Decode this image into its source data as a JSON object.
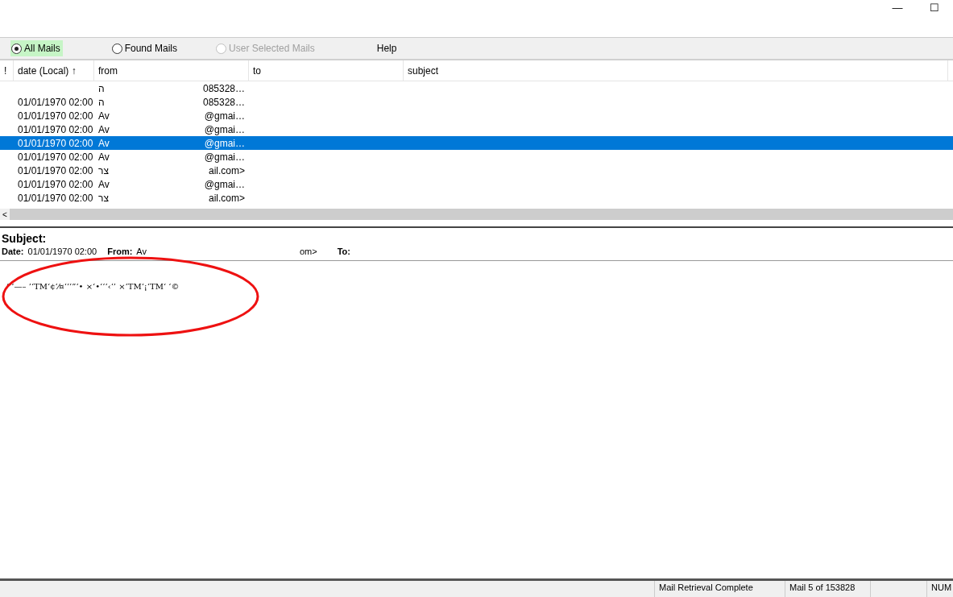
{
  "window": {
    "controls": [
      "—",
      "☐"
    ]
  },
  "toolbar": {
    "options": [
      {
        "label": "All Mails",
        "selected": true,
        "disabled": false
      },
      {
        "label": "Found Mails",
        "selected": false,
        "disabled": false
      },
      {
        "label": "User Selected Mails",
        "selected": false,
        "disabled": true
      }
    ],
    "help": "Help"
  },
  "table": {
    "columns": [
      "!",
      "date (Local) ↑",
      "from",
      "to",
      "subject"
    ],
    "rows": [
      {
        "date": "",
        "from": "ה",
        "from_tail": "085328…",
        "selected": false
      },
      {
        "date": "01/01/1970 02:00",
        "from": "ה",
        "from_tail": "085328…",
        "selected": false
      },
      {
        "date": "01/01/1970 02:00",
        "from": "Av",
        "from_tail": "@gmai…",
        "selected": false
      },
      {
        "date": "01/01/1970 02:00",
        "from": "Av",
        "from_tail": "@gmai…",
        "selected": false
      },
      {
        "date": "01/01/1970 02:00",
        "from": "Av",
        "from_tail": "@gmai…",
        "selected": true
      },
      {
        "date": "01/01/1970 02:00",
        "from": "Av",
        "from_tail": "@gmai…",
        "selected": false
      },
      {
        "date": "01/01/1970 02:00",
        "from": "צר",
        "from_tail": "ail.com>",
        "selected": false
      },
      {
        "date": "01/01/1970 02:00",
        "from": "Av",
        "from_tail": "@gmai…",
        "selected": false
      },
      {
        "date": "01/01/1970 02:00",
        "from": "צר",
        "from_tail": "ail.com>",
        "selected": false
      }
    ]
  },
  "preview": {
    "subject_label": "Subject:",
    "date_label": "Date:",
    "date": "01/01/1970 02:00",
    "from_label": "From:",
    "from": "Av",
    "from_tail": "om>",
    "to_label": "To:",
    "body": "‘‘‘—– ’‘TM‘¢‘⁄¤‘’’”‘• ×‘•‘‘‘‹‘’ ×‘TM‘¡‘TM‘ ‘©"
  },
  "scrollbar": {
    "left_arrow": "<"
  },
  "status_bar": {
    "panes": [
      "Mail Retrieval Complete",
      "Mail 5 of 153828",
      "NUM"
    ]
  }
}
